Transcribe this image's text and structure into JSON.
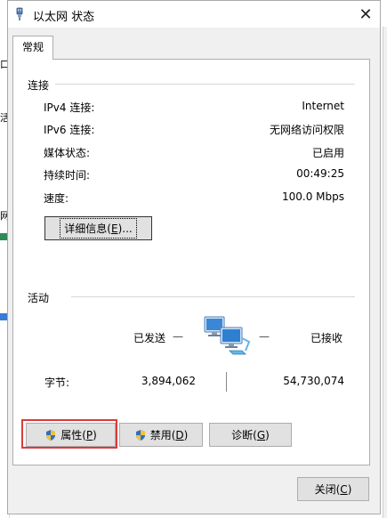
{
  "window": {
    "title": "以太网 状态",
    "close_glyph": "✕"
  },
  "tabs": [
    {
      "label": "常规"
    }
  ],
  "connection": {
    "heading": "连接",
    "rows": [
      {
        "label": "IPv4 连接:",
        "value": "Internet"
      },
      {
        "label": "IPv6 连接:",
        "value": "无网络访问权限"
      },
      {
        "label": "媒体状态:",
        "value": "已启用"
      },
      {
        "label": "持续时间:",
        "value": "00:49:25"
      },
      {
        "label": "速度:",
        "value": "100.0 Mbps"
      }
    ],
    "details_button": {
      "text": "详细信息(",
      "key": "E",
      "suffix": ")..."
    }
  },
  "activity": {
    "heading": "活动",
    "sent_label": "已发送",
    "received_label": "已接收",
    "dash": "—",
    "bytes_label": "字节:",
    "bytes_sent": "3,894,062",
    "bytes_received": "54,730,074"
  },
  "action_buttons": {
    "properties": {
      "text": "属性(",
      "key": "P",
      "suffix": ")"
    },
    "disable": {
      "text": "禁用(",
      "key": "D",
      "suffix": ")"
    },
    "diagnose": {
      "text": "诊断(",
      "key": "G",
      "suffix": ")"
    }
  },
  "close_button": {
    "text": "关闭(",
    "key": "C",
    "suffix": ")"
  },
  "background_window_glyphs": [
    "口",
    "活",
    "网"
  ],
  "colors": {
    "highlight": "#d83b3b",
    "window_bg": "#f0f0f0",
    "button_bg": "#e1e1e1"
  }
}
